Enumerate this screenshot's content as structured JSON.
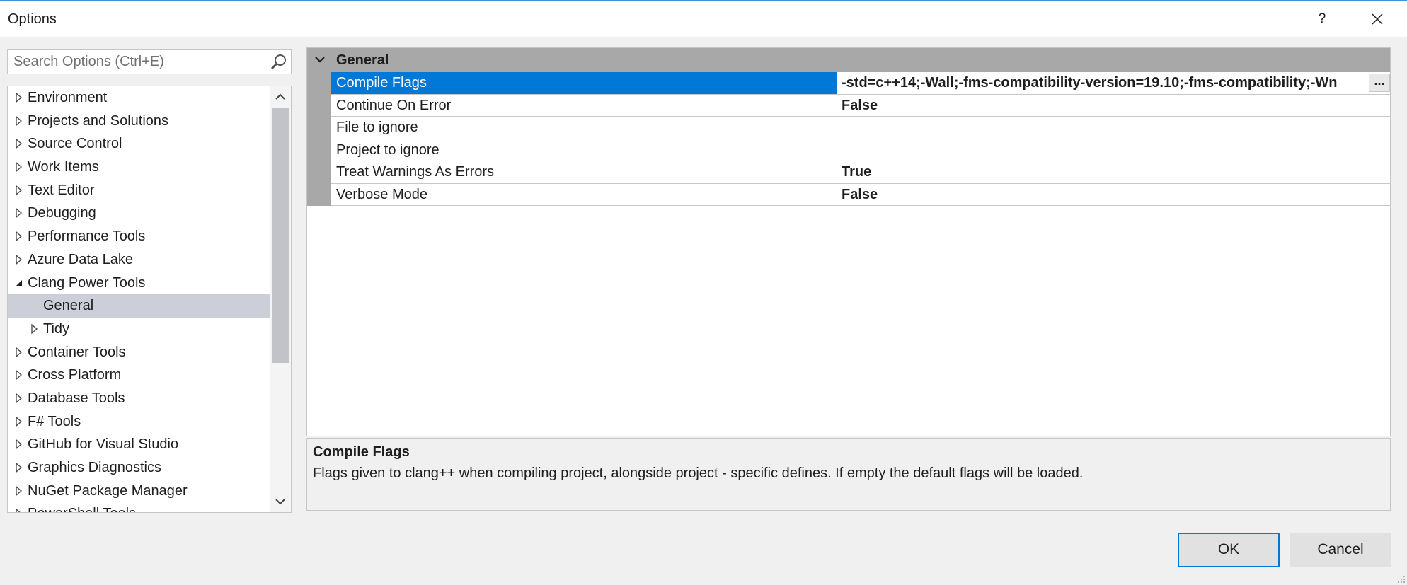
{
  "window": {
    "title": "Options",
    "help_label": "?",
    "accent_color": "#0078d7"
  },
  "search": {
    "placeholder": "Search Options (Ctrl+E)",
    "icon": "search-icon"
  },
  "tree": {
    "items": [
      {
        "label": "Environment",
        "level": 0,
        "state": "collapsed"
      },
      {
        "label": "Projects and Solutions",
        "level": 0,
        "state": "collapsed"
      },
      {
        "label": "Source Control",
        "level": 0,
        "state": "collapsed"
      },
      {
        "label": "Work Items",
        "level": 0,
        "state": "collapsed"
      },
      {
        "label": "Text Editor",
        "level": 0,
        "state": "collapsed"
      },
      {
        "label": "Debugging",
        "level": 0,
        "state": "collapsed"
      },
      {
        "label": "Performance Tools",
        "level": 0,
        "state": "collapsed"
      },
      {
        "label": "Azure Data Lake",
        "level": 0,
        "state": "collapsed"
      },
      {
        "label": "Clang Power Tools",
        "level": 0,
        "state": "expanded"
      },
      {
        "label": "General",
        "level": 1,
        "state": "leaf",
        "selected": true
      },
      {
        "label": "Tidy",
        "level": 1,
        "state": "collapsed"
      },
      {
        "label": "Container Tools",
        "level": 0,
        "state": "collapsed"
      },
      {
        "label": "Cross Platform",
        "level": 0,
        "state": "collapsed"
      },
      {
        "label": "Database Tools",
        "level": 0,
        "state": "collapsed"
      },
      {
        "label": "F# Tools",
        "level": 0,
        "state": "collapsed"
      },
      {
        "label": "GitHub for Visual Studio",
        "level": 0,
        "state": "collapsed"
      },
      {
        "label": "Graphics Diagnostics",
        "level": 0,
        "state": "collapsed"
      },
      {
        "label": "NuGet Package Manager",
        "level": 0,
        "state": "collapsed"
      },
      {
        "label": "PowerShell Tools",
        "level": 0,
        "state": "collapsed"
      }
    ]
  },
  "grid": {
    "category": "General",
    "rows": [
      {
        "name": "Compile Flags",
        "value": "-std=c++14;-Wall;-fms-compatibility-version=19.10;-fms-compatibility;-Wn",
        "selected": true,
        "has_ellipsis": true
      },
      {
        "name": "Continue On Error",
        "value": "False"
      },
      {
        "name": "File to ignore",
        "value": ""
      },
      {
        "name": "Project to ignore",
        "value": ""
      },
      {
        "name": "Treat Warnings As Errors",
        "value": "True"
      },
      {
        "name": "Verbose Mode",
        "value": "False"
      }
    ],
    "ellipsis_label": "..."
  },
  "description": {
    "title": "Compile Flags",
    "text": "Flags given to clang++ when compiling project, alongside project - specific defines. If empty the default flags will be loaded."
  },
  "buttons": {
    "ok_label": "OK",
    "cancel_label": "Cancel"
  }
}
